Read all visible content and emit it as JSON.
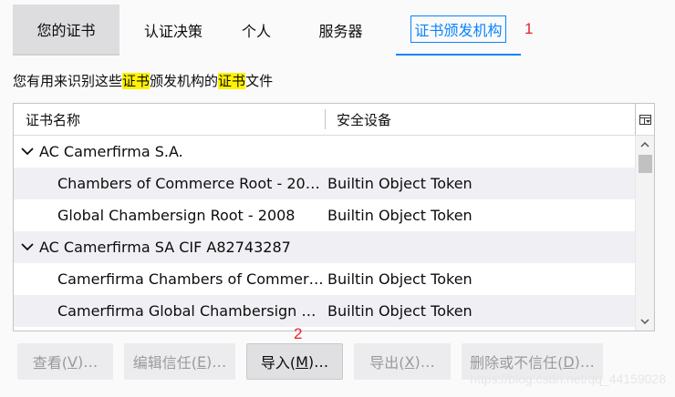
{
  "tabs": [
    {
      "label": "您的证书",
      "selected": true
    },
    {
      "label": "认证决策"
    },
    {
      "label": "个人"
    },
    {
      "label": "服务器"
    },
    {
      "label": "证书颁发机构",
      "active": true
    }
  ],
  "annotations": {
    "one": "1",
    "two": "2"
  },
  "description": {
    "part1": "您有用来识别这些",
    "highlight1": "证书",
    "part2": "颁发机构的",
    "highlight2": "证书",
    "part3": "文件"
  },
  "table": {
    "columns": {
      "name": "证书名称",
      "device": "安全设备"
    },
    "rows": [
      {
        "type": "group",
        "name": "AC Camerfirma S.A."
      },
      {
        "type": "child",
        "name": "Chambers of Commerce Root - 20…",
        "device": "Builtin Object Token"
      },
      {
        "type": "child",
        "name": "Global Chambersign Root - 2008",
        "device": "Builtin Object Token"
      },
      {
        "type": "group",
        "name": "AC Camerfirma SA CIF A82743287"
      },
      {
        "type": "child",
        "name": "Camerfirma Chambers of Commer…",
        "device": "Builtin Object Token"
      },
      {
        "type": "child",
        "name": "Camerfirma Global Chambersign …",
        "device": "Builtin Object Token"
      }
    ]
  },
  "buttons": {
    "view": {
      "label": "查看(",
      "key": "V",
      "suffix": ")…",
      "enabled": false
    },
    "edit_trust": {
      "label": "编辑信任(",
      "key": "E",
      "suffix": ")…",
      "enabled": false
    },
    "import": {
      "label": "导入(",
      "key": "M",
      "suffix": ")…",
      "enabled": true
    },
    "export": {
      "label": "导出(",
      "key": "X",
      "suffix": ")…",
      "enabled": false
    },
    "delete": {
      "label": "删除或不信任(",
      "key": "D",
      "suffix": ")…",
      "enabled": false
    }
  },
  "watermark": "https://blog.csdn.net/qq_44159028",
  "colors": {
    "accent": "#0a84ff",
    "highlight": "#fff200",
    "annotation": "#e8202f"
  }
}
